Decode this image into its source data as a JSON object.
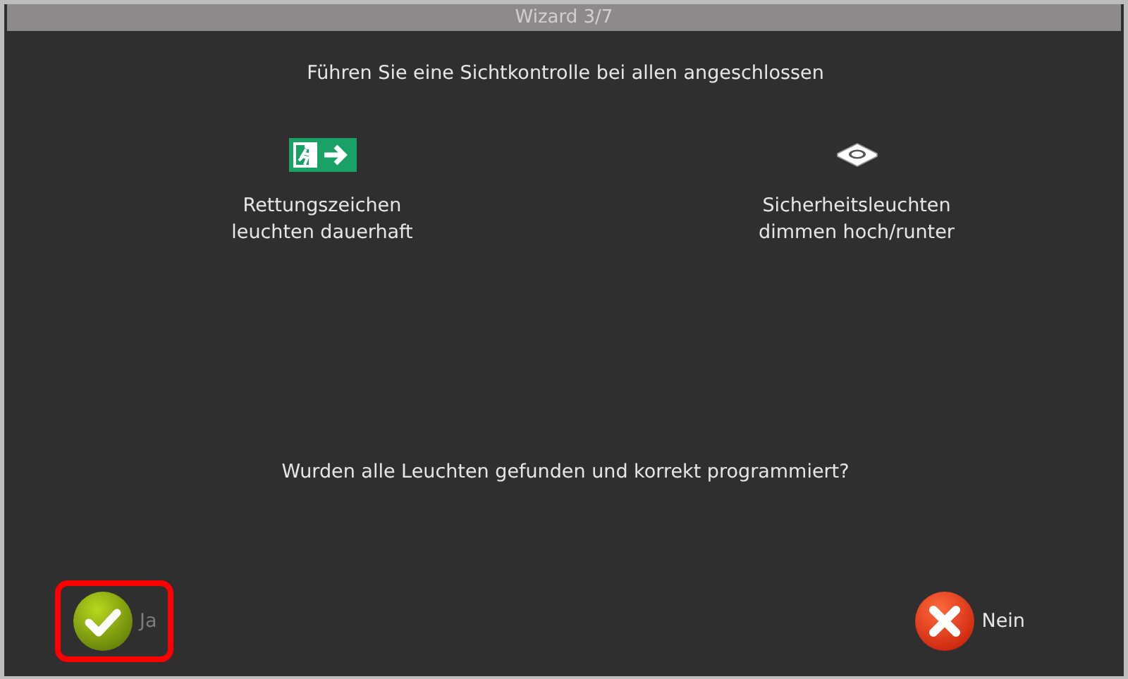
{
  "window": {
    "title": "Wizard 3/7"
  },
  "instruction": "Führen Sie eine Sichtkontrolle bei allen angeschlossen",
  "checks": [
    {
      "kind": "exit-sign",
      "label": "Rettungszeichen\nleuchten dauerhaft"
    },
    {
      "kind": "ceiling-light",
      "label": "Sicherheitsleuchten\ndimmen hoch/runter"
    }
  ],
  "question": "Wurden alle Leuchten gefunden und korrekt programmiert?",
  "buttons": [
    {
      "kind": "yes",
      "label": "Ja",
      "highlighted": true
    },
    {
      "kind": "no",
      "label": "Nein",
      "highlighted": false
    }
  ]
}
